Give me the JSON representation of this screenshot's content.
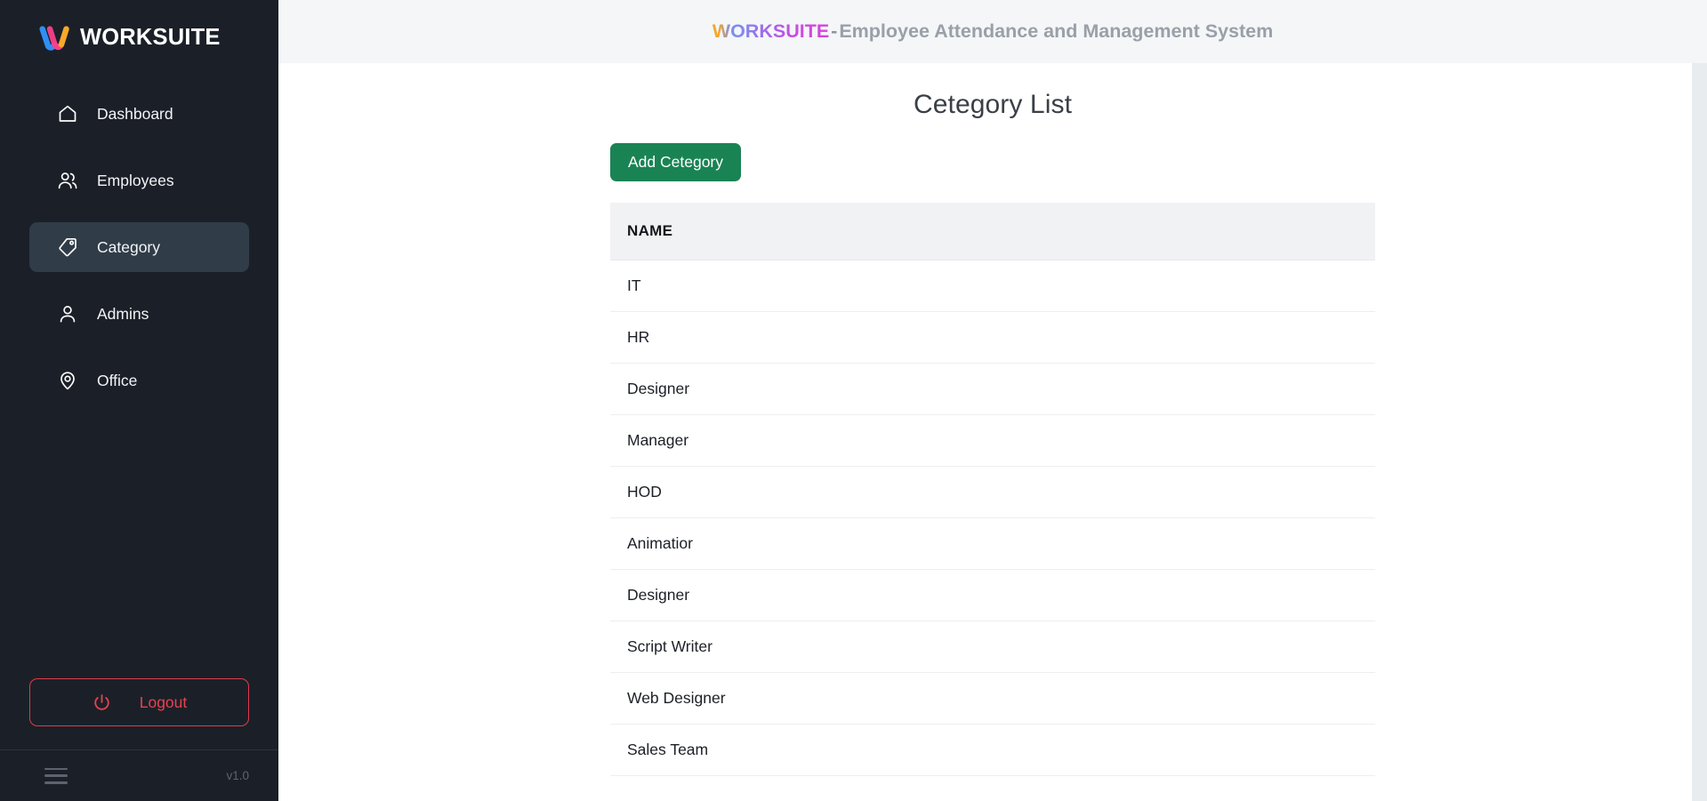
{
  "sidebar": {
    "brand": {
      "logo_icon": "worksuite-w-logo-icon",
      "text": "WORKSUITE",
      "colors": {
        "logo_blue": "#2f8ff5",
        "logo_pink": "#f7418a",
        "logo_orange": "#f9a82b"
      }
    },
    "items": [
      {
        "label": "Dashboard",
        "icon": "home-icon",
        "active": false
      },
      {
        "label": "Employees",
        "icon": "users-icon",
        "active": false
      },
      {
        "label": "Category",
        "icon": "tag-icon",
        "active": true
      },
      {
        "label": "Admins",
        "icon": "user-icon",
        "active": false
      },
      {
        "label": "Office",
        "icon": "map-pin-icon",
        "active": false
      }
    ],
    "logout": {
      "label": "Logout",
      "icon": "power-icon",
      "color": "#e8414f"
    },
    "footer": {
      "menu_icon": "hamburger-icon",
      "version": "v1.0"
    },
    "background": "#1b2028",
    "active_background": "#303c48"
  },
  "topbar": {
    "brand": "WORKSUITE",
    "separator": "-",
    "subtitle": "Employee Attendance and Management System",
    "background": "#f4f6f8"
  },
  "main": {
    "page_title": "Cetegory List",
    "add_button": {
      "label": "Add Cetegory",
      "color": "#1a8354"
    },
    "table": {
      "columns": [
        "NAME"
      ],
      "rows": [
        {
          "name": "IT"
        },
        {
          "name": "HR"
        },
        {
          "name": "Designer"
        },
        {
          "name": "Manager"
        },
        {
          "name": "HOD"
        },
        {
          "name": "Animatior"
        },
        {
          "name": "Designer"
        },
        {
          "name": "Script Writer"
        },
        {
          "name": "Web Designer"
        },
        {
          "name": "Sales Team"
        }
      ],
      "header_background": "#f1f2f4"
    }
  }
}
